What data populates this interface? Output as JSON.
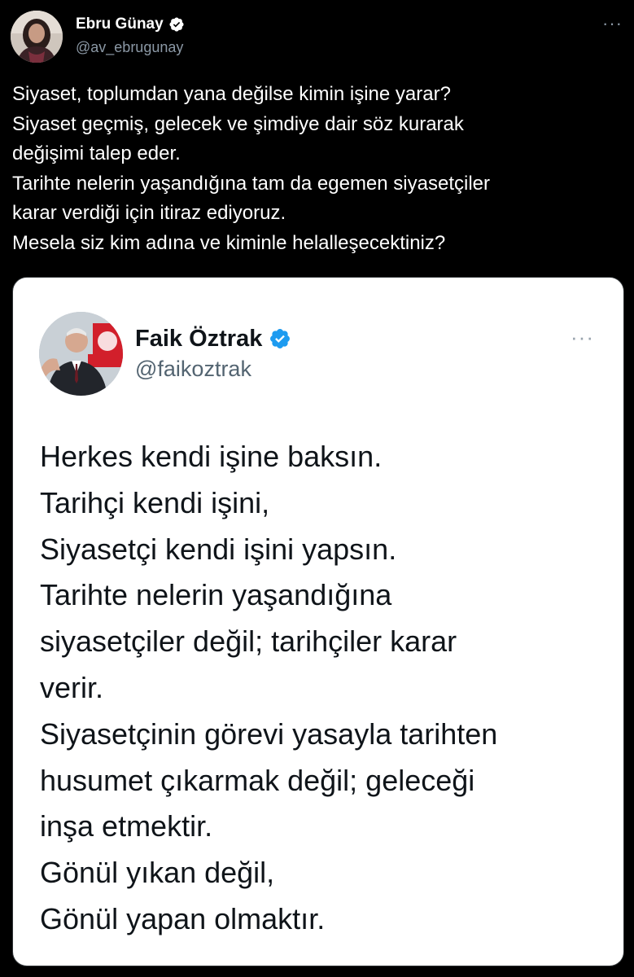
{
  "tweet": {
    "author": {
      "name": "Ebru Günay",
      "handle": "@av_ebrugunay",
      "verified": true
    },
    "more_label": "···",
    "text_lines": [
      "Siyaset, toplumdan yana değilse kimin işine yarar?",
      "Siyaset geçmiş, gelecek ve şimdiye dair söz kurarak",
      "değişimi talep eder.",
      "Tarihte nelerin yaşandığına tam da egemen siyasetçiler",
      "karar verdiği için itiraz ediyoruz.",
      "Mesela siz kim adına ve kiminle helalleşecektiniz?"
    ],
    "quoted": {
      "author": {
        "name": "Faik Öztrak",
        "handle": "@faikoztrak",
        "verified": true
      },
      "more_label": "···",
      "text_lines": [
        "Herkes kendi işine baksın.",
        "Tarihçi kendi işini,",
        "Siyasetçi kendi işini yapsın.",
        "Tarihte nelerin yaşandığına",
        "siyasetçiler değil; tarihçiler karar",
        "verir.",
        "Siyasetçinin görevi yasayla tarihten",
        "husumet çıkarmak değil; geleceği",
        "inşa etmektir.",
        "Gönül yıkan değil,",
        "Gönül yapan olmaktır."
      ]
    }
  },
  "colors": {
    "background": "#000000",
    "text_primary_dark": "#ffffff",
    "text_secondary_dark": "#8b98a5",
    "card_background": "#ffffff",
    "text_primary_light": "#0f1419",
    "text_secondary_light": "#536471",
    "verified_blue": "#1d9bf0"
  },
  "icons": {
    "verified": "verified-badge-icon",
    "more": "more-horizontal-icon"
  }
}
